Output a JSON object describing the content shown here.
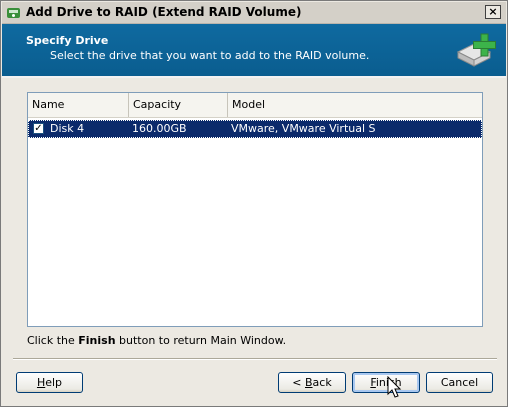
{
  "window": {
    "title": "Add Drive to RAID (Extend RAID Volume)",
    "close_label": "×"
  },
  "header": {
    "title": "Specify Drive",
    "subtitle": "Select the drive that you want to add to the RAID volume."
  },
  "table": {
    "columns": [
      "Name",
      "Capacity",
      "Model"
    ],
    "rows": [
      {
        "checked": true,
        "name": "Disk 4",
        "capacity": "160.00GB",
        "model": "VMware, VMware Virtual S"
      }
    ]
  },
  "hint": {
    "prefix": "Click the ",
    "bold": "Finish",
    "suffix": " button to return Main Window."
  },
  "buttons": {
    "help": {
      "access_key": "H",
      "rest": "elp"
    },
    "back": {
      "prefix": "< ",
      "access_key": "B",
      "rest": "ack"
    },
    "finish": {
      "access_key": "F",
      "rest": "inish"
    },
    "cancel": "Cancel"
  },
  "icons": {
    "title": "raid-app-icon",
    "header": "add-drive-icon",
    "cursor": "mouse-pointer-icon"
  },
  "colors": {
    "header_bg": "#0f6aa0",
    "selection_bg": "#0b2a6b"
  }
}
